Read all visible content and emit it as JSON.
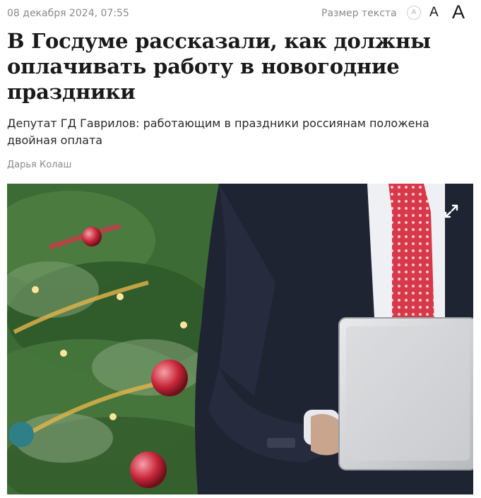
{
  "article": {
    "date": "08 декабря 2024, 07:55",
    "text_size_label": "Размер текста",
    "size_options": [
      "A",
      "A",
      "A"
    ],
    "headline": "В Госдуме рассказали, как должны оплачивать работу в новогодние праздники",
    "subtitle": "Депутат ГД Гаврилов: работающим в праздники россиянам положена двойная оплата",
    "author": "Дарья Колаш"
  },
  "photo": {
    "expand_icon": "expand-icon"
  },
  "colors": {
    "text": "#1a1a1a",
    "muted": "#8a8a8a",
    "suit": "#1f2433",
    "tie": "#d8394a",
    "tree": "#2f5a2a"
  }
}
